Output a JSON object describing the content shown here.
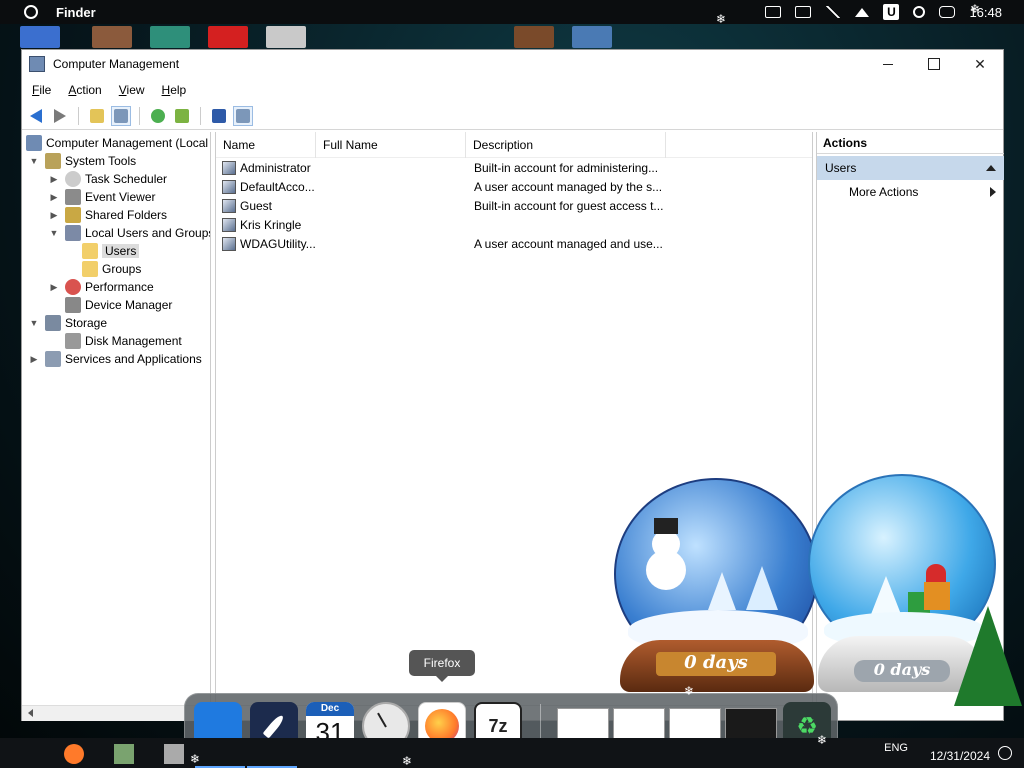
{
  "menubar": {
    "app_name": "Finder",
    "clock": "16:48",
    "user_badge": "U",
    "icons": [
      "cloud-icon",
      "monitor-icon",
      "mute-icon",
      "eject-icon",
      "user-icon",
      "search-icon",
      "control-center-icon"
    ]
  },
  "window": {
    "title": "Computer Management",
    "menu": [
      "File",
      "Action",
      "View",
      "Help"
    ],
    "tree": [
      {
        "label": "Computer Management (Local",
        "level": 0,
        "expander": "",
        "icon": "computer-icon"
      },
      {
        "label": "System Tools",
        "level": 1,
        "expander": "open",
        "icon": "tools-icon"
      },
      {
        "label": "Task Scheduler",
        "level": 2,
        "expander": "closed",
        "icon": "clock-icon"
      },
      {
        "label": "Event Viewer",
        "level": 2,
        "expander": "closed",
        "icon": "event-icon"
      },
      {
        "label": "Shared Folders",
        "level": 2,
        "expander": "closed",
        "icon": "share-icon"
      },
      {
        "label": "Local Users and Groups",
        "level": 2,
        "expander": "open",
        "icon": "users-icon"
      },
      {
        "label": "Users",
        "level": 3,
        "expander": "",
        "icon": "folder-icon",
        "selected": true
      },
      {
        "label": "Groups",
        "level": 3,
        "expander": "",
        "icon": "folder-icon"
      },
      {
        "label": "Performance",
        "level": 2,
        "expander": "closed",
        "icon": "performance-icon"
      },
      {
        "label": "Device Manager",
        "level": 2,
        "expander": "",
        "icon": "device-icon"
      },
      {
        "label": "Storage",
        "level": 1,
        "expander": "open",
        "icon": "storage-icon"
      },
      {
        "label": "Disk Management",
        "level": 2,
        "expander": "",
        "icon": "disk-icon"
      },
      {
        "label": "Services and Applications",
        "level": 1,
        "expander": "closed",
        "icon": "services-icon"
      }
    ],
    "list": {
      "columns": [
        "Name",
        "Full Name",
        "Description"
      ],
      "rows": [
        {
          "name": "Administrator",
          "full_name": "",
          "description": "Built-in account for administering..."
        },
        {
          "name": "DefaultAcco...",
          "full_name": "",
          "description": "A user account managed by the s..."
        },
        {
          "name": "Guest",
          "full_name": "",
          "description": "Built-in account for guest access t..."
        },
        {
          "name": "Kris Kringle",
          "full_name": "",
          "description": ""
        },
        {
          "name": "WDAGUtility...",
          "full_name": "",
          "description": "A user account managed and use..."
        }
      ]
    },
    "actions": {
      "header": "Actions",
      "section": "Users",
      "more": "More Actions"
    }
  },
  "widgets": {
    "countdown_1": "0 days",
    "countdown_2": "0 days"
  },
  "dock": {
    "tooltip": "Firefox",
    "calendar_month": "Dec",
    "calendar_day": "31",
    "sevenzip_label": "7z"
  },
  "taskbar": {
    "language": "ENG",
    "date": "12/31/2024"
  }
}
